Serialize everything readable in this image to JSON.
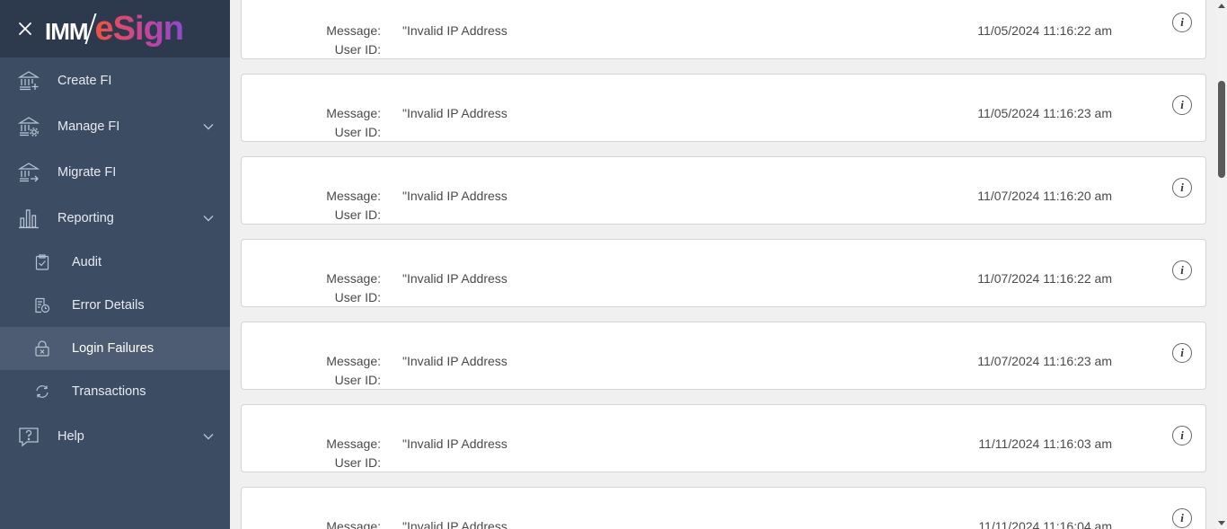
{
  "app": {
    "logo_text_part1": "IMM",
    "logo_text_part2": "eSign",
    "brand_gradient": [
      "#f0533f",
      "#c8449a",
      "#8b4cc9"
    ]
  },
  "sidebar": {
    "items": [
      {
        "label": "Create FI",
        "icon": "bank-add-icon"
      },
      {
        "label": "Manage FI",
        "icon": "bank-settings-icon",
        "expandable": true
      },
      {
        "label": "Migrate FI",
        "icon": "bank-migrate-icon"
      },
      {
        "label": "Reporting",
        "icon": "bar-chart-icon",
        "expandable": true,
        "expanded": true
      },
      {
        "label": "Help",
        "icon": "help-chat-icon",
        "expandable": true
      }
    ],
    "reporting_sub": [
      {
        "label": "Audit",
        "icon": "clipboard-check-icon"
      },
      {
        "label": "Error Details",
        "icon": "document-clock-icon"
      },
      {
        "label": "Login Failures",
        "icon": "lock-x-icon",
        "active": true
      },
      {
        "label": "Transactions",
        "icon": "sync-arrows-icon"
      }
    ],
    "colors": {
      "background": "#3c4c63",
      "header": "#2d3a4e",
      "active": "#4d5c72"
    }
  },
  "records": {
    "message_label": "Message:",
    "user_id_label": "User ID:",
    "items": [
      {
        "message": "\"Invalid IP Address",
        "user_id": "",
        "timestamp": "11/05/2024 11:16:22 am"
      },
      {
        "message": "\"Invalid IP Address",
        "user_id": "",
        "timestamp": "11/05/2024 11:16:23 am"
      },
      {
        "message": "\"Invalid IP Address",
        "user_id": "",
        "timestamp": "11/07/2024 11:16:20 am"
      },
      {
        "message": "\"Invalid IP Address",
        "user_id": "",
        "timestamp": "11/07/2024 11:16:22 am"
      },
      {
        "message": "\"Invalid IP Address",
        "user_id": "",
        "timestamp": "11/07/2024 11:16:23 am"
      },
      {
        "message": "\"Invalid IP Address",
        "user_id": "",
        "timestamp": "11/11/2024 11:16:03 am"
      },
      {
        "message": "\"Invalid IP Address",
        "user_id": "",
        "timestamp": "11/11/2024 11:16:04 am"
      }
    ]
  }
}
